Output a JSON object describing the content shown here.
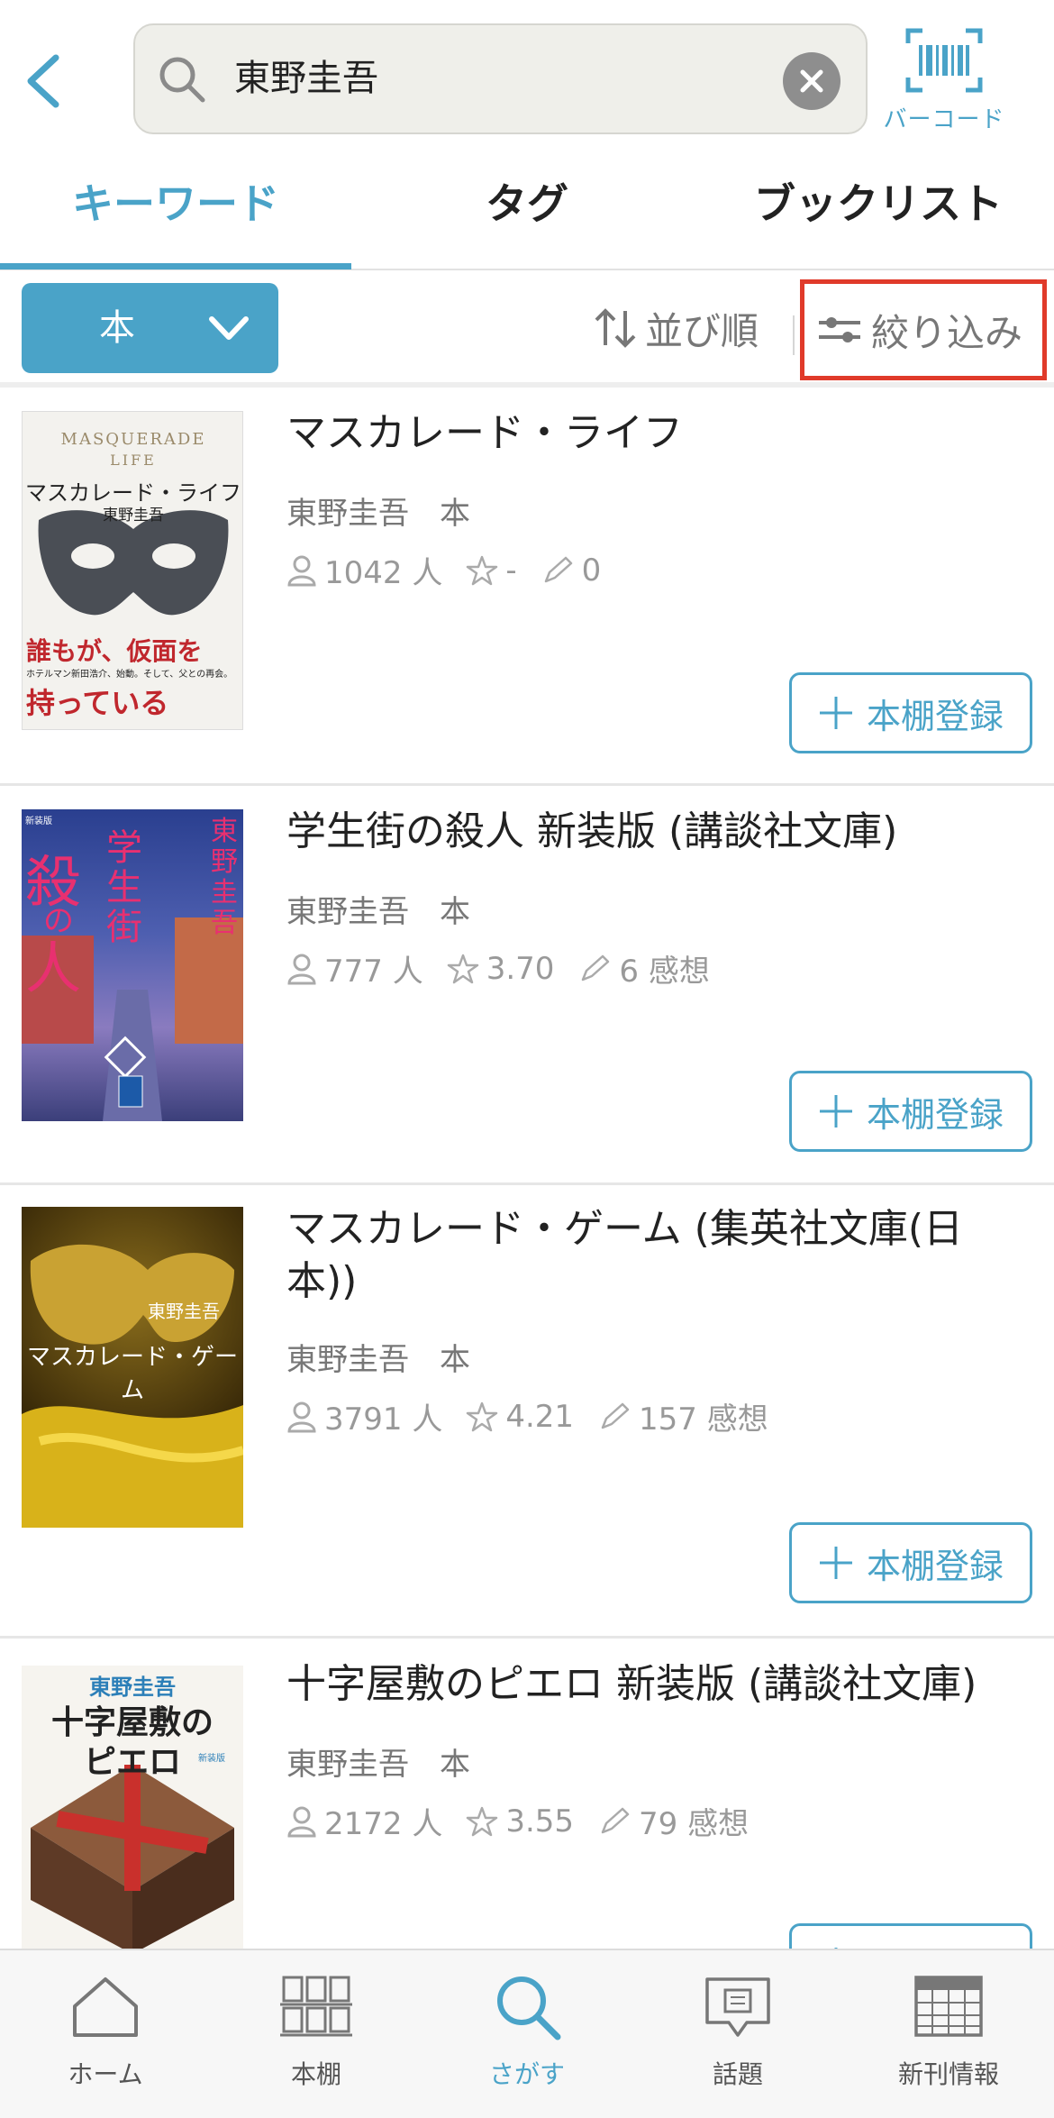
{
  "header": {
    "search_query": "東野圭吾",
    "barcode_label": "バーコード"
  },
  "tabs": [
    {
      "label": "キーワード",
      "active": true
    },
    {
      "label": "タグ",
      "active": false
    },
    {
      "label": "ブックリスト",
      "active": false
    }
  ],
  "filterbar": {
    "type_label": "本",
    "sort_label": "並び順",
    "filter_label": "絞り込み"
  },
  "results": [
    {
      "title": "マスカレード・ライフ",
      "author": "東野圭吾",
      "type": "本",
      "readers": "1042 人",
      "rating": "-",
      "reviews": "0",
      "add_label": "本棚登録",
      "cover_texts": [
        "MASQUERADE",
        "LIFE",
        "マスカレード・ライフ",
        "東野圭吾",
        "誰もが、仮面を",
        "ホテルマン新田浩介、始動。そして、父との再会。",
        "持っている"
      ]
    },
    {
      "title": "学生街の殺人 新装版 (講談社文庫)",
      "author": "東野圭吾",
      "type": "本",
      "readers": "777 人",
      "rating": "3.70",
      "reviews": "6 感想",
      "add_label": "本棚登録",
      "cover_texts": [
        "新装版",
        "学",
        "生",
        "街",
        "殺",
        "の",
        "人",
        "東野圭吾"
      ]
    },
    {
      "title": "マスカレード・ゲーム (集英社文庫(日本))",
      "author": "東野圭吾",
      "type": "本",
      "readers": "3791 人",
      "rating": "4.21",
      "reviews": "157 感想",
      "add_label": "本棚登録",
      "cover_texts": [
        "東野圭吾",
        "マスカレード・ゲーム"
      ]
    },
    {
      "title": "十字屋敷のピエロ 新装版 (講談社文庫)",
      "author": "東野圭吾",
      "type": "本",
      "readers": "2172 人",
      "rating": "3.55",
      "reviews": "79 感想",
      "add_label": "本棚登録",
      "cover_texts": [
        "東野圭吾",
        "十字屋敷の",
        "ピエロ",
        "新装版"
      ]
    }
  ],
  "bottomnav": [
    {
      "label": "ホーム",
      "icon": "home-icon",
      "active": false
    },
    {
      "label": "本棚",
      "icon": "bookshelf-icon",
      "active": false
    },
    {
      "label": "さがす",
      "icon": "search-icon",
      "active": true
    },
    {
      "label": "話題",
      "icon": "topic-icon",
      "active": false
    },
    {
      "label": "新刊情報",
      "icon": "calendar-icon",
      "active": false
    }
  ],
  "colors": {
    "accent": "#4aa3c8",
    "highlight": "#e03a2a"
  }
}
